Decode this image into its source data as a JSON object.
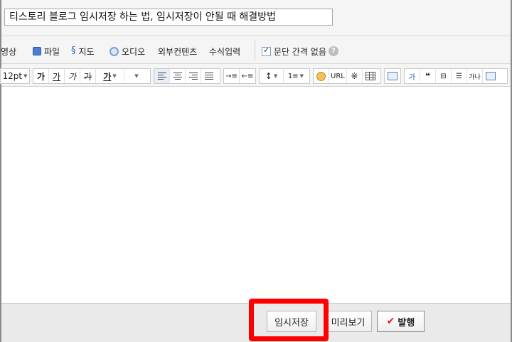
{
  "post": {
    "title": "티스토리 블로그 임시저장 하는 법, 임시저장이 안될 때 해결방법"
  },
  "insert_toolbar": {
    "video": "동영상",
    "file": "파일",
    "map": "지도",
    "audio": "오디오",
    "external": "외부컨텐츠",
    "formula": "수식입력",
    "no_paragraph_spacing": "문단 간격 없음",
    "help": "?"
  },
  "format_toolbar": {
    "font_size": "12pt",
    "bold": "가",
    "underline": "가",
    "italic": "가",
    "strike": "가",
    "font_color": "가",
    "url": "URL",
    "reference_mark": "※",
    "box": "가",
    "quote": "❝",
    "footnote": "가나"
  },
  "actions": {
    "save_draft": "임시저장",
    "preview": "미리보기",
    "publish": "발행"
  },
  "colors": {
    "highlight": "#ff0000",
    "publish_check": "#e02020"
  }
}
